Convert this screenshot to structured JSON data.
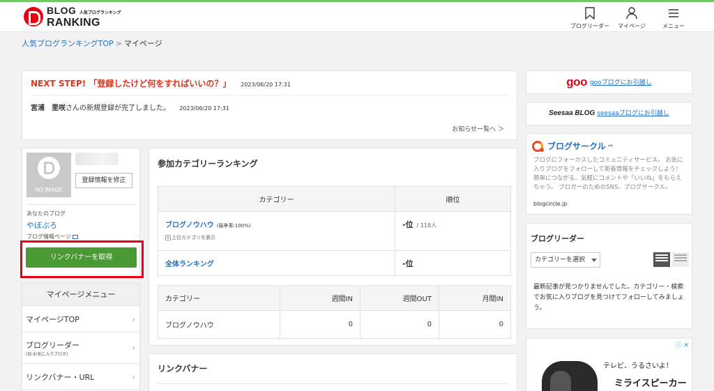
{
  "header": {
    "logo_line1": "BLOG",
    "logo_line1_small": "人気ブログランキング",
    "logo_line2": "RANKING",
    "nav": [
      {
        "label": "ブログリーダー",
        "icon": "bookmark-icon"
      },
      {
        "label": "マイページ",
        "icon": "user-icon"
      },
      {
        "label": "メニュー",
        "icon": "hamburger-icon"
      }
    ]
  },
  "breadcrumb": {
    "home": "人気ブログランキングTOP",
    "sep": ">",
    "current": "マイページ"
  },
  "notice": {
    "title": "NEXT STEP! 「登録したけど何をすればいいの？」",
    "title_date": "2023/06/20 17:31",
    "user_name": "宮浦　里咲",
    "message": "さんの新規登録が完了しました。",
    "message_date": "2023/06/20 17:31",
    "more_link": "お知らせ一覧へ ＞"
  },
  "profile": {
    "no_image": "NO IMAGE",
    "edit_button": "登録情報を修正",
    "your_blog_label": "あなたのブログ",
    "blog_name": "やぼぶろ",
    "blog_info_link": "ブログ情報ページ",
    "link_banner_button": "リンクバナーを取得"
  },
  "menu": {
    "title": "マイページメニュー",
    "items": [
      {
        "label": "マイページTOP",
        "sub": ""
      },
      {
        "label": "ブログリーダー",
        "sub": "(旧:お気に入りブログ)"
      },
      {
        "label": "リンクバナー・URL",
        "sub": ""
      }
    ]
  },
  "ranking": {
    "title": "参加カテゴリーランキング",
    "table1": {
      "headers": [
        "カテゴリー",
        "順位"
      ],
      "rows": [
        {
          "category": "ブログノウハウ",
          "rate": "(競争率:100%)",
          "sub": "上位カテゴリを表示",
          "rank": "-位",
          "total": "/ 118人"
        },
        {
          "category": "全体ランキング",
          "rank": "-位"
        }
      ]
    },
    "table2": {
      "headers": [
        "カテゴリー",
        "週間IN",
        "週間OUT",
        "月間IN"
      ],
      "rows": [
        {
          "category": "ブログノウハウ",
          "week_in": "0",
          "week_out": "0",
          "month_in": "0"
        }
      ]
    }
  },
  "banner": {
    "title": "リンクバナー"
  },
  "right": {
    "goo_logo": "goo",
    "goo_link": "gooブログにお引越し",
    "seesaa_logo": "Seesaa BLOG",
    "seesaa_link": "seesaaブログにお引越し",
    "circle_title": "ブログサークル",
    "circle_desc": "ブログにフォーカスしたコミュニティサービス。 お気に入りブログをフォローして新着情報をチェックしよう！ 簡単につながる、気軽にコメントや「いいね」をもらえちゃう。 ブロガーのためのSNS、ブログサークル。",
    "circle_url": "blogcircle.jp",
    "reader_title": "ブログリーダー",
    "reader_select": "カテゴリーを選択",
    "reader_msg": "最新記事が見つかりませんでした。カテゴリー・検索でお気に入りブログを見つけてフォローしてみましょう。",
    "ad_line1": "テレビ、うるさいよ！",
    "ad_line2": "ミライスピーカー",
    "ad_badge": "ⓘ ✕"
  },
  "colors": {
    "accent_green": "#4a9a34",
    "alert_red": "#e60012",
    "link_blue": "#1d6fc8",
    "top_line": "#74c865"
  }
}
